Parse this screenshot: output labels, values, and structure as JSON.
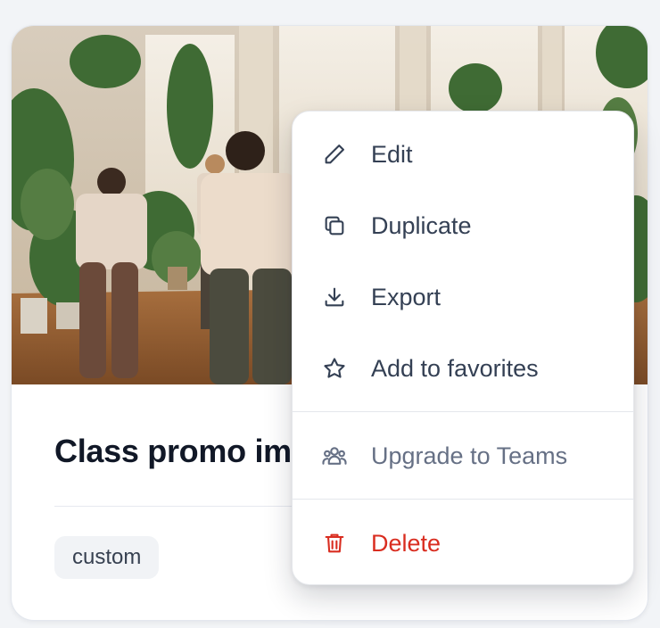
{
  "card": {
    "title": "Class promo image",
    "tag": "custom"
  },
  "menu": {
    "items": [
      {
        "label": "Edit",
        "icon": "pencil-icon"
      },
      {
        "label": "Duplicate",
        "icon": "copy-icon"
      },
      {
        "label": "Export",
        "icon": "download-icon"
      },
      {
        "label": "Add to favorites",
        "icon": "star-icon"
      },
      {
        "label": "Upgrade to Teams",
        "icon": "users-icon"
      },
      {
        "label": "Delete",
        "icon": "trash-icon"
      }
    ]
  },
  "colors": {
    "text": "#344054",
    "muted": "#667085",
    "danger": "#d92d20",
    "title": "#111827"
  }
}
